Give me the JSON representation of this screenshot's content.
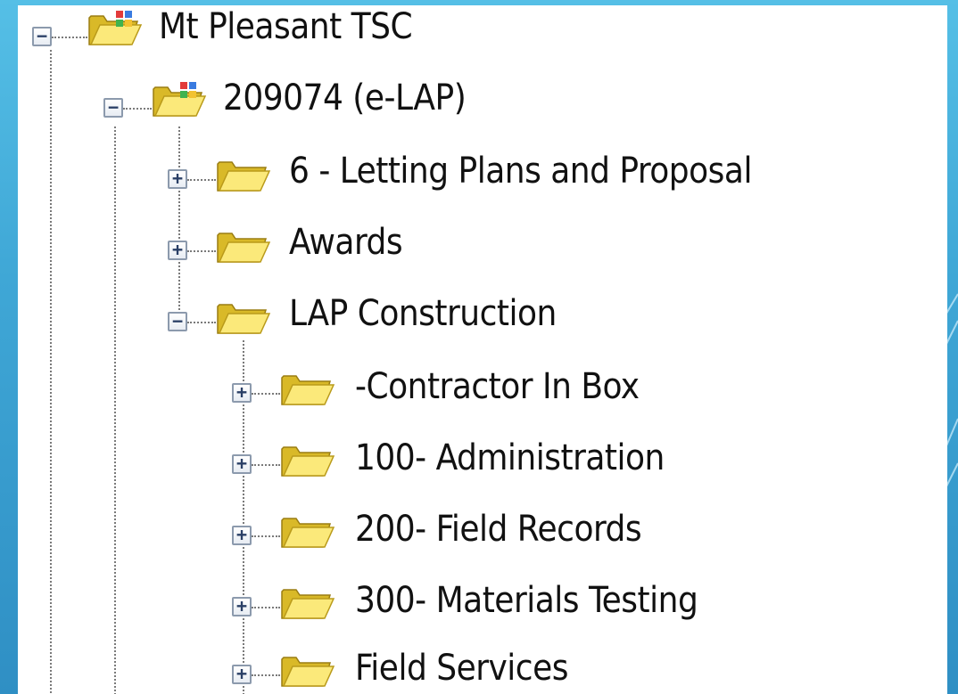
{
  "tree": {
    "root": {
      "label": "Mt Pleasant TSC",
      "expanded": true,
      "icon": "project-folder-icon"
    },
    "project": {
      "label": "209074 (e-LAP)",
      "expanded": true,
      "icon": "project-folder-icon"
    },
    "children": [
      {
        "label": "6 - Letting Plans and Proposal",
        "expanded": false,
        "icon": "folder-icon"
      },
      {
        "label": "Awards",
        "expanded": false,
        "icon": "folder-icon"
      },
      {
        "label": "LAP Construction",
        "expanded": true,
        "icon": "folder-icon"
      }
    ],
    "lap_children": [
      {
        "label": "-Contractor In Box",
        "expanded": false,
        "icon": "folder-icon"
      },
      {
        "label": "100- Administration",
        "expanded": false,
        "icon": "folder-icon"
      },
      {
        "label": "200- Field Records",
        "expanded": false,
        "icon": "folder-icon"
      },
      {
        "label": "300- Materials Testing",
        "expanded": false,
        "icon": "folder-icon"
      },
      {
        "label": "Field Services",
        "expanded": false,
        "icon": "folder-icon"
      }
    ],
    "expand_glyph": "+",
    "collapse_glyph": "−"
  },
  "colors": {
    "background_top": "#55bfe6",
    "background_bottom": "#2f8fc4",
    "panel": "#ffffff",
    "folder_yellow": "#f5e15a"
  }
}
